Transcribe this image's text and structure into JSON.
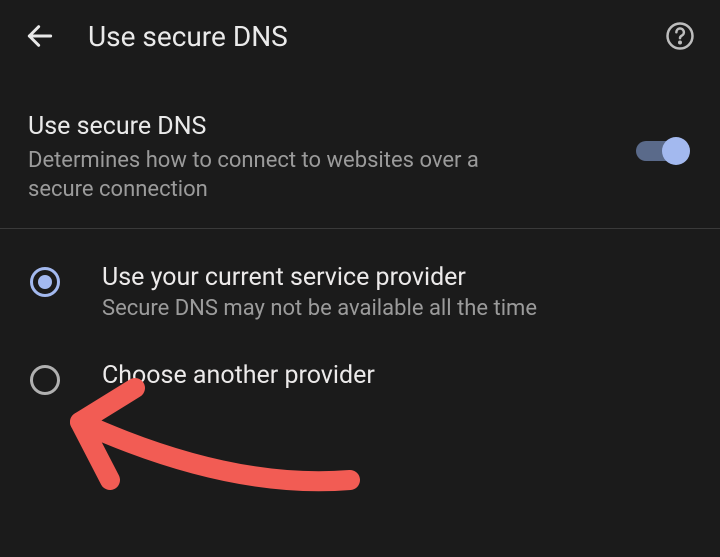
{
  "appbar": {
    "title": "Use secure DNS"
  },
  "section": {
    "heading": "Use secure DNS",
    "subtext": "Determines how to connect to websites over a secure connection",
    "toggle_on": true
  },
  "options": {
    "current": {
      "label": "Use your current service provider",
      "sublabel": "Secure DNS may not be available all the time",
      "selected": true
    },
    "another": {
      "label": "Choose another provider",
      "selected": false
    }
  },
  "colors": {
    "accent": "#a3b9ef",
    "annotation": "#f25c54"
  }
}
